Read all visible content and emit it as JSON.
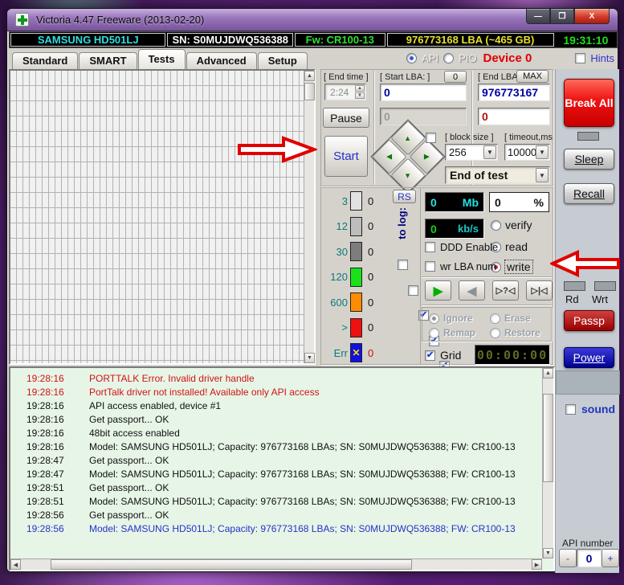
{
  "window": {
    "title": "Victoria 4.47  Freeware (2013-02-20)",
    "min": "—",
    "max": "❐",
    "close": "X"
  },
  "infobar": {
    "model": "SAMSUNG HD501LJ",
    "serial": "SN: S0MUJDWQ536388",
    "firmware": "Fw: CR100-13",
    "capacity": "976773168 LBA (~465 GB)",
    "clock": "19:31:10",
    "colors": {
      "model": "#2ee0e0",
      "serial": "#ffffff",
      "firmware": "#30e030",
      "capacity": "#e8e030",
      "clock": "#22dd22"
    }
  },
  "tabs": [
    "Standard",
    "SMART",
    "Tests",
    "Advanced",
    "Setup"
  ],
  "active_tab": "Tests",
  "mode": {
    "api": "API",
    "pio": "PIO",
    "device": "Device 0",
    "hints": "Hints"
  },
  "test_controls": {
    "end_time_label": "[ End time ]",
    "end_time_value": "2:24",
    "pause": "Pause",
    "start": "Start",
    "start_lba_label": "[ Start LBA: ]",
    "start_lba_btn": "0",
    "start_lba_value": "0",
    "start_lba_value2": "0",
    "end_lba_label": "[ End LBA: ]",
    "end_lba_btn": "MAX",
    "end_lba_value": "976773167",
    "end_lba_value2": "0",
    "block_size_label": "[ block size ]",
    "block_size_value": "256",
    "timeout_label": "[ timeout,ms ]",
    "timeout_value": "10000",
    "end_action": "End of test"
  },
  "speed_scale": {
    "rs": "RS",
    "to_log": "to log:",
    "rows": [
      {
        "label": "3",
        "count": "0",
        "color": "#e2e2e2",
        "checkbox": false,
        "checked": false,
        "count_color": "#111"
      },
      {
        "label": "12",
        "count": "0",
        "color": "#bdbdbd",
        "checkbox": false,
        "checked": false,
        "count_color": "#111"
      },
      {
        "label": "30",
        "count": "0",
        "color": "#7d7d7d",
        "checkbox": true,
        "checked": false,
        "count_color": "#111"
      },
      {
        "label": "120",
        "count": "0",
        "color": "#1ae11a",
        "checkbox": true,
        "checked": false,
        "count_color": "#111"
      },
      {
        "label": "600",
        "count": "0",
        "color": "#ff8c00",
        "checkbox": true,
        "checked": true,
        "count_color": "#111"
      },
      {
        "label": ">",
        "count": "0",
        "color": "#f01010",
        "checkbox": true,
        "checked": true,
        "count_color": "#111"
      },
      {
        "label": "Err",
        "count": "0",
        "color": "#1010e0",
        "checkbox": true,
        "checked": true,
        "count_color": "#cc1010",
        "err_mark": "✕"
      }
    ]
  },
  "monitor": {
    "mb_value": "0",
    "mb_unit": "Mb",
    "pct_value": "0",
    "pct_unit": "%",
    "kbs_value": "0",
    "kbs_unit": "kb/s",
    "radio_verify": "verify",
    "radio_read": "read",
    "radio_write": "write",
    "selected_mode": "write",
    "ddd": "DDD Enable",
    "wrlba": "wr LBA num",
    "media": [
      "▶",
      "◀",
      "▷?◁",
      "▷|◁"
    ],
    "defect": {
      "ignore": "Ignore",
      "remap": "Remap",
      "erase": "Erase",
      "restore": "Restore",
      "selected": "Ignore"
    },
    "grid": "Grid",
    "timer": "00:00:00"
  },
  "sidebar": {
    "break_all": "Break All",
    "sleep": "Sleep",
    "recall": "Recall",
    "rd": "Rd",
    "wrt": "Wrt",
    "passp": "Passp",
    "power": "Power",
    "sound": "sound",
    "api_number_label": "API number",
    "api_minus": "-",
    "api_value": "0",
    "api_plus": "+"
  },
  "log": {
    "entries": [
      {
        "time": "19:28:16",
        "text": "PORTTALK Error. Invalid driver handle",
        "color": "#d01414"
      },
      {
        "time": "19:28:16",
        "text": "PortTalk driver not installed! Available only API access",
        "color": "#d01414"
      },
      {
        "time": "19:28:16",
        "text": "API access enabled, device #1",
        "color": "#101010"
      },
      {
        "time": "19:28:16",
        "text": "Get passport... OK",
        "color": "#101010"
      },
      {
        "time": "19:28:16",
        "text": "48bit access enabled",
        "color": "#101010"
      },
      {
        "time": "19:28:16",
        "text": "Model: SAMSUNG HD501LJ; Capacity: 976773168 LBAs; SN: S0MUJDWQ536388; FW: CR100-13",
        "color": "#101010"
      },
      {
        "time": "19:28:47",
        "text": "Get passport... OK",
        "color": "#101010"
      },
      {
        "time": "19:28:47",
        "text": "Model: SAMSUNG HD501LJ; Capacity: 976773168 LBAs; SN: S0MUJDWQ536388; FW: CR100-13",
        "color": "#101010"
      },
      {
        "time": "19:28:51",
        "text": "Get passport... OK",
        "color": "#101010"
      },
      {
        "time": "19:28:51",
        "text": "Model: SAMSUNG HD501LJ; Capacity: 976773168 LBAs; SN: S0MUJDWQ536388; FW: CR100-13",
        "color": "#101010"
      },
      {
        "time": "19:28:56",
        "text": "Get passport... OK",
        "color": "#101010"
      },
      {
        "time": "19:28:56",
        "text": "Model: SAMSUNG HD501LJ; Capacity: 976773168 LBAs; SN: S0MUJDWQ536388; FW: CR100-13",
        "color": "#2333c8"
      }
    ]
  }
}
